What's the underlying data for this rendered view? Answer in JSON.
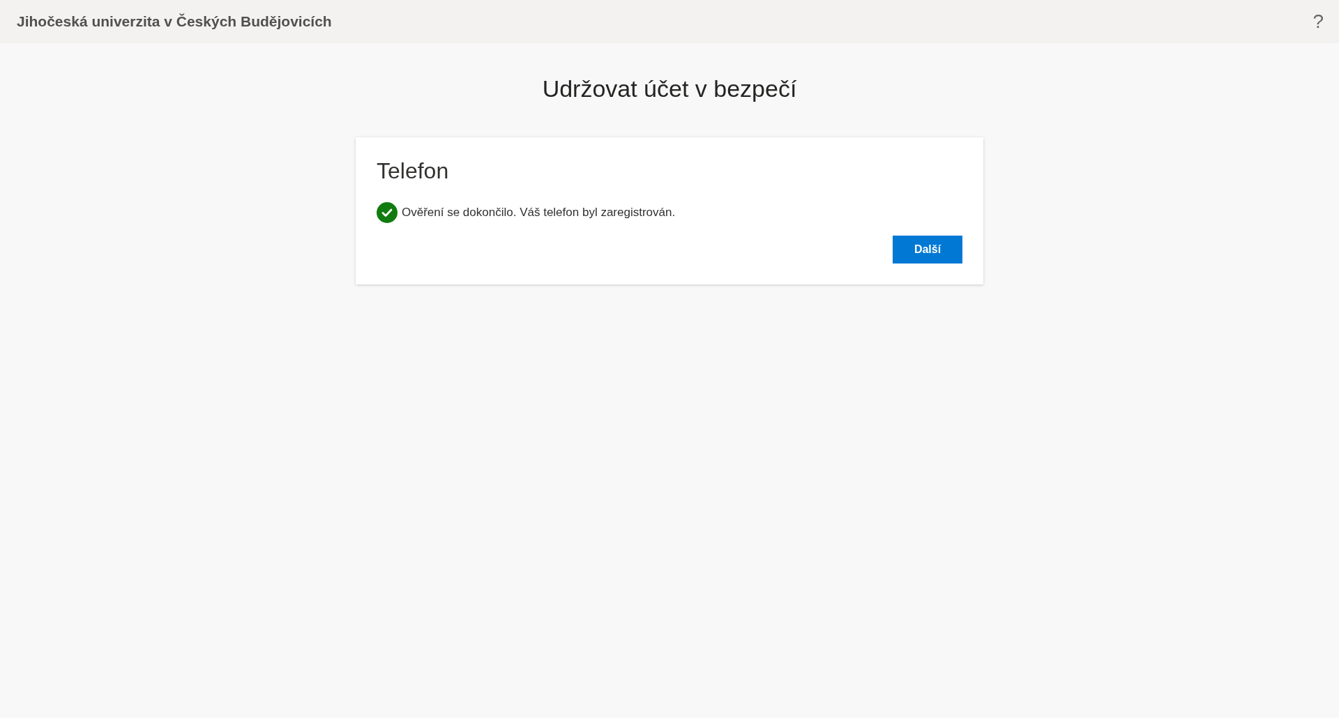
{
  "header": {
    "organization": "Jihočeská univerzita v Českých Budějovicích",
    "help": "?"
  },
  "page_title": "Udržovat účet v bezpečí",
  "card": {
    "title": "Telefon",
    "message": "Ověření se dokončilo. Váš telefon byl zaregistrován.",
    "button": "Další"
  }
}
